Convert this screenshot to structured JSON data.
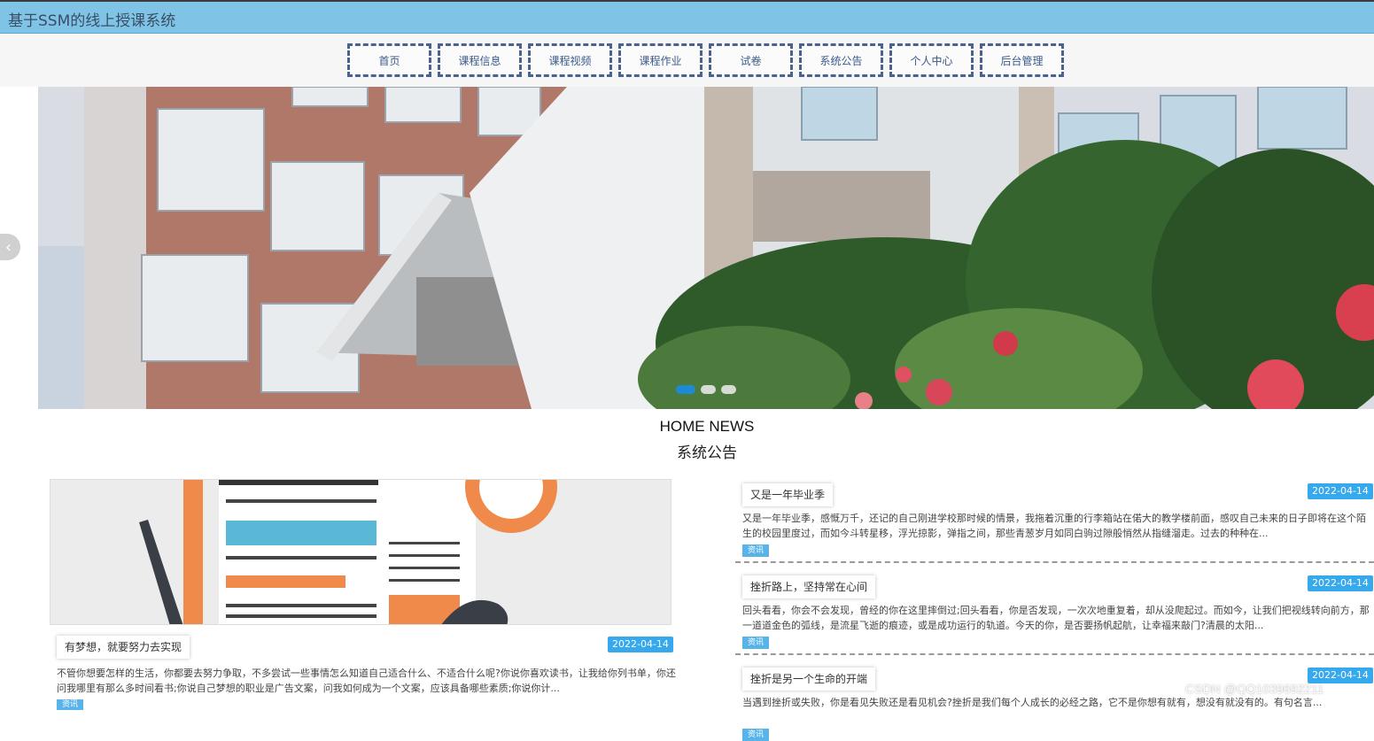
{
  "app": {
    "title": "基于SSM的线上授课系统"
  },
  "nav": {
    "items": [
      {
        "label": "首页"
      },
      {
        "label": "课程信息"
      },
      {
        "label": "课程视频"
      },
      {
        "label": "课程作业"
      },
      {
        "label": "试卷"
      },
      {
        "label": "系统公告"
      },
      {
        "label": "个人中心"
      },
      {
        "label": "后台管理"
      }
    ]
  },
  "banner": {
    "prev_icon": "chevron-left-icon",
    "prev_glyph": "‹",
    "slide_count": 3,
    "active_slide": 1
  },
  "section": {
    "title_en": "HOME NEWS",
    "title_cn": "系统公告"
  },
  "featured": {
    "title": "有梦想，就要努力去实现",
    "date": "2022-04-14",
    "excerpt": "不管你想要怎样的生活，你都要去努力争取，不多尝试一些事情怎么知道自己适合什么、不适合什么呢?你说你喜欢读书，让我给你列书单，你还问我哪里有那么多时间看书;你说自己梦想的职业是广告文案，问我如何成为一个文案，应该具备哪些素质;你说你计...",
    "tag": "资讯"
  },
  "news": [
    {
      "title": "又是一年毕业季",
      "date": "2022-04-14",
      "excerpt": "又是一年毕业季，感慨万千，还记的自己刚进学校那时候的情景，我拖着沉重的行李箱站在偌大的教学楼前面，感叹自己未来的日子即将在这个陌生的校园里度过，而如今斗转星移，浮光掠影，弹指之间，那些青葱岁月如同白驹过隙般悄然从指缝溜走。过去的种种在...",
      "tag": "资讯"
    },
    {
      "title": "挫折路上，坚持常在心间",
      "date": "2022-04-14",
      "excerpt": "回头看看，你会不会发现，曾经的你在这里摔倒过;回头看看，你是否发现，一次次地重复着，却从没爬起过。而如今，让我们把视线转向前方，那一道道金色的弧线，是流星飞逝的痕迹，或是成功运行的轨道。今天的你，是否要扬帆起航，让幸福来敲门?清晨的太阳...",
      "tag": "资讯"
    },
    {
      "title": "挫折是另一个生命的开端",
      "date": "2022-04-14",
      "excerpt": "当遇到挫折或失败，你是看见失败还是看见机会?挫折是我们每个人成长的必经之路，它不是你想有就有，想没有就没有的。有句名言...",
      "tag": "资讯"
    }
  ],
  "watermark": "CSDN @QQ1039692211",
  "colors": {
    "header": "#7fc4e6",
    "nav_border": "#4a6290",
    "date_badge": "#36a8ec",
    "tag": "#57b3e8"
  }
}
